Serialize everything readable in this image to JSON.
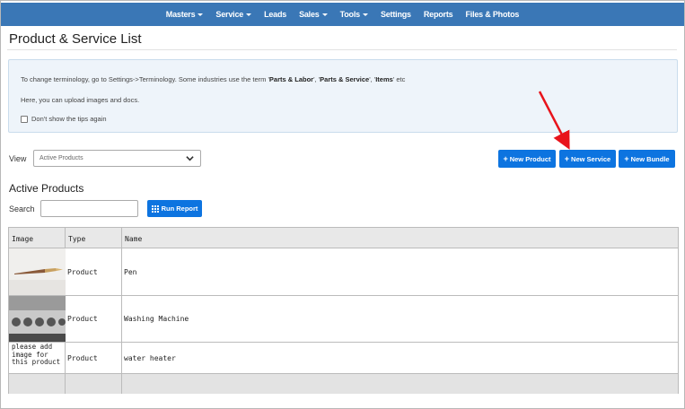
{
  "nav": {
    "items": [
      {
        "label": "Masters",
        "dropdown": true
      },
      {
        "label": "Service",
        "dropdown": true
      },
      {
        "label": "Leads",
        "dropdown": false
      },
      {
        "label": "Sales",
        "dropdown": true
      },
      {
        "label": "Tools",
        "dropdown": true
      },
      {
        "label": "Settings",
        "dropdown": false
      },
      {
        "label": "Reports",
        "dropdown": false
      },
      {
        "label": "Files & Photos",
        "dropdown": false
      }
    ]
  },
  "page": {
    "title": "Product & Service List"
  },
  "tips": {
    "line1_prefix": "To change terminology, go to Settings->Terminology. Some industries use the term '",
    "term1": "Parts & Labor",
    "sep1": "', '",
    "term2": "Parts & Service",
    "sep2": "', '",
    "term3": "Items",
    "line1_suffix": "' etc",
    "line2": "Here, you can upload images and docs.",
    "checkbox_label": "Don't show the tips again"
  },
  "view": {
    "label": "View",
    "selected": "Active Products"
  },
  "buttons": {
    "new_product": "New Product",
    "new_service": "New Service",
    "new_bundle": "New Bundle",
    "run_report": "Run Report"
  },
  "section": {
    "title": "Active Products"
  },
  "search": {
    "label": "Search",
    "value": ""
  },
  "table": {
    "headers": [
      "Image",
      "Type",
      "Name"
    ],
    "rows": [
      {
        "image": "pen-image",
        "type": "Product",
        "name": "Pen"
      },
      {
        "image": "washing-machine-image",
        "type": "Product",
        "name": "Washing Machine"
      },
      {
        "image_text": "please add image for this product",
        "type": "Product",
        "name": "water heater"
      }
    ]
  },
  "colors": {
    "navbar": "#3a77b6",
    "button": "#0d74e0",
    "tips_bg": "#eef4fa",
    "annotation_arrow": "#e8131b"
  }
}
